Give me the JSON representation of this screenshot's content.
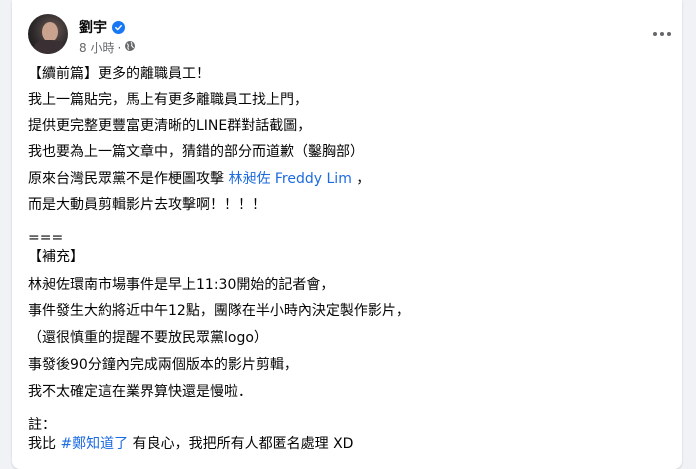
{
  "post": {
    "author": "劉宇",
    "timestamp": "8 小時",
    "separator": "·",
    "audience_icon": "globe-icon",
    "more_icon": "more-options-icon",
    "accent_color": "#1877f2",
    "link_color": "#1c6be0"
  },
  "body": {
    "line1": "【續前篇】更多的離職員工！",
    "line2": "我上一篇貼完，馬上有更多離職員工找上門，",
    "line3": "提供更完整更豐富更清晰的LINE群對話截圖，",
    "line4": "我也要為上一篇文章中，猜錯的部分而道歉（鑿胸部）",
    "line5_before": "原來台灣民眾黨不是作梗圖攻擊",
    "line5_link": "林昶佐 Freddy Lim",
    "line5_after": "，",
    "line6": "而是大動員剪輯影片去攻擊啊！！！！",
    "line7": "===",
    "line8": "【補充】",
    "line9": "林昶佐環南市場事件是早上11:30開始的記者會，",
    "line10": "事件發生大約將近中午12點，團隊在半小時內決定製作影片，",
    "line11": "（還很慎重的提醒不要放民眾黨logo）",
    "line12": "事發後90分鐘內完成兩個版本的影片剪輯，",
    "line13": "我不太確定這在業界算快還是慢啦．",
    "line14": "註：",
    "line15_before": "我比",
    "line15_link": "#鄭知道了",
    "line15_after": "有良心，我把所有人都匿名處理 XD"
  }
}
